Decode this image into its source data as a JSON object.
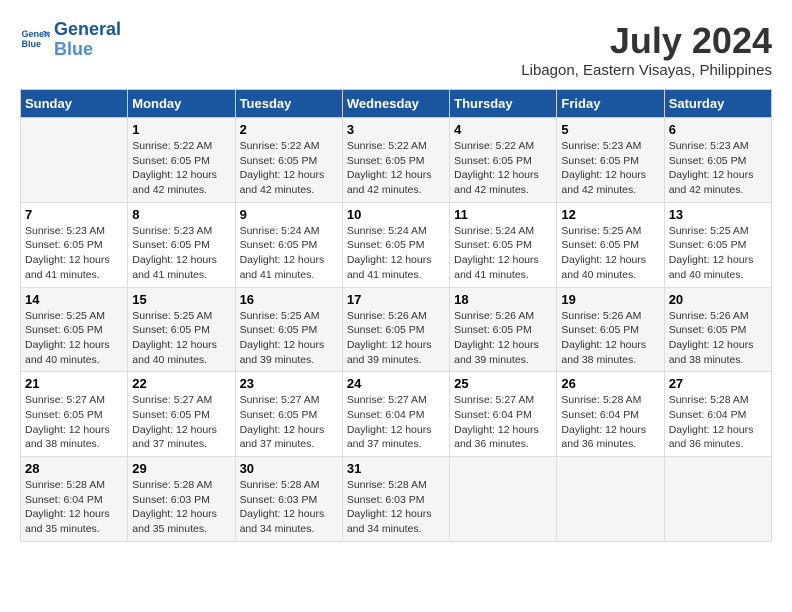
{
  "logo": {
    "line1": "General",
    "line2": "Blue"
  },
  "title": "July 2024",
  "subtitle": "Libagon, Eastern Visayas, Philippines",
  "days_header": [
    "Sunday",
    "Monday",
    "Tuesday",
    "Wednesday",
    "Thursday",
    "Friday",
    "Saturday"
  ],
  "weeks": [
    [
      {
        "num": "",
        "info": ""
      },
      {
        "num": "1",
        "info": "Sunrise: 5:22 AM\nSunset: 6:05 PM\nDaylight: 12 hours\nand 42 minutes."
      },
      {
        "num": "2",
        "info": "Sunrise: 5:22 AM\nSunset: 6:05 PM\nDaylight: 12 hours\nand 42 minutes."
      },
      {
        "num": "3",
        "info": "Sunrise: 5:22 AM\nSunset: 6:05 PM\nDaylight: 12 hours\nand 42 minutes."
      },
      {
        "num": "4",
        "info": "Sunrise: 5:22 AM\nSunset: 6:05 PM\nDaylight: 12 hours\nand 42 minutes."
      },
      {
        "num": "5",
        "info": "Sunrise: 5:23 AM\nSunset: 6:05 PM\nDaylight: 12 hours\nand 42 minutes."
      },
      {
        "num": "6",
        "info": "Sunrise: 5:23 AM\nSunset: 6:05 PM\nDaylight: 12 hours\nand 42 minutes."
      }
    ],
    [
      {
        "num": "7",
        "info": "Sunrise: 5:23 AM\nSunset: 6:05 PM\nDaylight: 12 hours\nand 41 minutes."
      },
      {
        "num": "8",
        "info": "Sunrise: 5:23 AM\nSunset: 6:05 PM\nDaylight: 12 hours\nand 41 minutes."
      },
      {
        "num": "9",
        "info": "Sunrise: 5:24 AM\nSunset: 6:05 PM\nDaylight: 12 hours\nand 41 minutes."
      },
      {
        "num": "10",
        "info": "Sunrise: 5:24 AM\nSunset: 6:05 PM\nDaylight: 12 hours\nand 41 minutes."
      },
      {
        "num": "11",
        "info": "Sunrise: 5:24 AM\nSunset: 6:05 PM\nDaylight: 12 hours\nand 41 minutes."
      },
      {
        "num": "12",
        "info": "Sunrise: 5:25 AM\nSunset: 6:05 PM\nDaylight: 12 hours\nand 40 minutes."
      },
      {
        "num": "13",
        "info": "Sunrise: 5:25 AM\nSunset: 6:05 PM\nDaylight: 12 hours\nand 40 minutes."
      }
    ],
    [
      {
        "num": "14",
        "info": "Sunrise: 5:25 AM\nSunset: 6:05 PM\nDaylight: 12 hours\nand 40 minutes."
      },
      {
        "num": "15",
        "info": "Sunrise: 5:25 AM\nSunset: 6:05 PM\nDaylight: 12 hours\nand 40 minutes."
      },
      {
        "num": "16",
        "info": "Sunrise: 5:25 AM\nSunset: 6:05 PM\nDaylight: 12 hours\nand 39 minutes."
      },
      {
        "num": "17",
        "info": "Sunrise: 5:26 AM\nSunset: 6:05 PM\nDaylight: 12 hours\nand 39 minutes."
      },
      {
        "num": "18",
        "info": "Sunrise: 5:26 AM\nSunset: 6:05 PM\nDaylight: 12 hours\nand 39 minutes."
      },
      {
        "num": "19",
        "info": "Sunrise: 5:26 AM\nSunset: 6:05 PM\nDaylight: 12 hours\nand 38 minutes."
      },
      {
        "num": "20",
        "info": "Sunrise: 5:26 AM\nSunset: 6:05 PM\nDaylight: 12 hours\nand 38 minutes."
      }
    ],
    [
      {
        "num": "21",
        "info": "Sunrise: 5:27 AM\nSunset: 6:05 PM\nDaylight: 12 hours\nand 38 minutes."
      },
      {
        "num": "22",
        "info": "Sunrise: 5:27 AM\nSunset: 6:05 PM\nDaylight: 12 hours\nand 37 minutes."
      },
      {
        "num": "23",
        "info": "Sunrise: 5:27 AM\nSunset: 6:05 PM\nDaylight: 12 hours\nand 37 minutes."
      },
      {
        "num": "24",
        "info": "Sunrise: 5:27 AM\nSunset: 6:04 PM\nDaylight: 12 hours\nand 37 minutes."
      },
      {
        "num": "25",
        "info": "Sunrise: 5:27 AM\nSunset: 6:04 PM\nDaylight: 12 hours\nand 36 minutes."
      },
      {
        "num": "26",
        "info": "Sunrise: 5:28 AM\nSunset: 6:04 PM\nDaylight: 12 hours\nand 36 minutes."
      },
      {
        "num": "27",
        "info": "Sunrise: 5:28 AM\nSunset: 6:04 PM\nDaylight: 12 hours\nand 36 minutes."
      }
    ],
    [
      {
        "num": "28",
        "info": "Sunrise: 5:28 AM\nSunset: 6:04 PM\nDaylight: 12 hours\nand 35 minutes."
      },
      {
        "num": "29",
        "info": "Sunrise: 5:28 AM\nSunset: 6:03 PM\nDaylight: 12 hours\nand 35 minutes."
      },
      {
        "num": "30",
        "info": "Sunrise: 5:28 AM\nSunset: 6:03 PM\nDaylight: 12 hours\nand 34 minutes."
      },
      {
        "num": "31",
        "info": "Sunrise: 5:28 AM\nSunset: 6:03 PM\nDaylight: 12 hours\nand 34 minutes."
      },
      {
        "num": "",
        "info": ""
      },
      {
        "num": "",
        "info": ""
      },
      {
        "num": "",
        "info": ""
      }
    ]
  ]
}
